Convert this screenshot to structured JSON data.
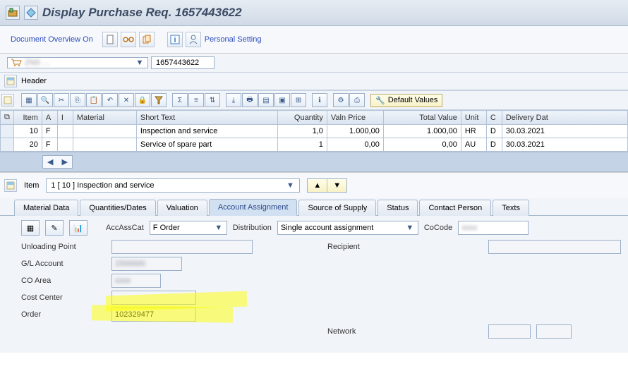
{
  "window": {
    "title": "Display Purchase Req. 1657443622"
  },
  "toolbar": {
    "doc_overview": "Document Overview On",
    "personal_setting": "Personal Setting"
  },
  "doc": {
    "type_text": "ZNS …",
    "number": "1657443622"
  },
  "sections": {
    "header": "Header",
    "item": "Item"
  },
  "grid": {
    "default_values": "Default Values",
    "cols": {
      "item": "Item",
      "a": "A",
      "i": "I",
      "material": "Material",
      "short_text": "Short Text",
      "quantity": "Quantity",
      "valn_price": "Valn Price",
      "total_value": "Total Value",
      "unit": "Unit",
      "c": "C",
      "delivery": "Delivery Dat"
    },
    "rows": [
      {
        "item": "10",
        "a": "F",
        "i": "",
        "material": "",
        "short_text": "Inspection and service",
        "quantity": "1,0",
        "valn_price": "1.000,00",
        "total_value": "1.000,00",
        "unit": "HR",
        "c": "D",
        "delivery": "30.03.2021"
      },
      {
        "item": "20",
        "a": "F",
        "i": "",
        "material": "",
        "short_text": "Service of spare part",
        "quantity": "1",
        "valn_price": "0,00",
        "total_value": "0,00",
        "unit": "AU",
        "c": "D",
        "delivery": "30.03.2021"
      }
    ]
  },
  "item_select": {
    "value": "1 [ 10 ] Inspection and service"
  },
  "tabs": [
    {
      "label": "Material Data"
    },
    {
      "label": "Quantities/Dates"
    },
    {
      "label": "Valuation"
    },
    {
      "label": "Account Assignment",
      "active": true
    },
    {
      "label": "Source of Supply"
    },
    {
      "label": "Status"
    },
    {
      "label": "Contact Person"
    },
    {
      "label": "Texts"
    }
  ],
  "form": {
    "acc_ass_cat_label": "AccAssCat",
    "acc_ass_cat_value": "F Order",
    "distribution_label": "Distribution",
    "distribution_value": "Single account assignment",
    "cocode_label": "CoCode",
    "cocode_value": "",
    "unloading_label": "Unloading Point",
    "unloading_value": "",
    "recipient_label": "Recipient",
    "recipient_value": "",
    "gl_label": "G/L Account",
    "gl_value": "",
    "co_area_label": "CO Area",
    "co_area_value": "",
    "cost_center_label": "Cost Center",
    "cost_center_value": "",
    "order_label": "Order",
    "order_value": "102329477",
    "network_label": "Network",
    "network_value": ""
  }
}
